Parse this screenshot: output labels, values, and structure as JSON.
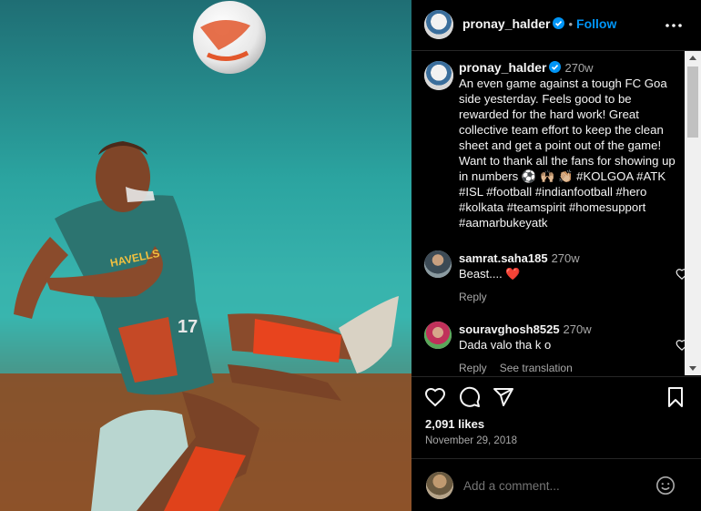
{
  "post": {
    "author": "pronay_halder",
    "follow_label": "Follow",
    "caption_time": "270w",
    "caption": "An even game against a tough FC Goa side yesterday. Feels good to be rewarded for the hard work! Great collective team effort to keep the clean sheet and get a point out of the game! Want to thank all the fans for showing up in numbers ⚽ 🙌🏼 👏🏼 #KOLGOA #ATK #ISL #football #indianfootball #hero #kolkata #teamspirit #homesupport #aamarbukeyatk",
    "likes": "2,091 likes",
    "date": "November 29, 2018"
  },
  "comments": [
    {
      "user": "samrat.saha185",
      "time": "270w",
      "text": "Beast.... ❤️",
      "reply": "Reply"
    },
    {
      "user": "souravghosh8525",
      "time": "270w",
      "text": "Dada valo tha k o",
      "reply": "Reply",
      "translate": "See translation"
    }
  ],
  "composer": {
    "placeholder": "Add a comment..."
  },
  "photo": {
    "jersey_text": "HAVELLS",
    "number": "17"
  },
  "colors": {
    "accent": "#0095f6",
    "like_red": "#ed4956",
    "teal": "#2aa39c"
  }
}
